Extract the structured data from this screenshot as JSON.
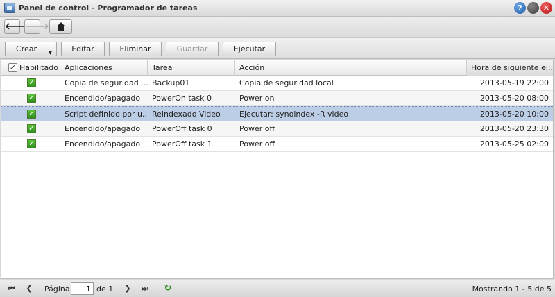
{
  "window": {
    "title": "Panel de control - Programador de tareas",
    "icon": "control-panel-icon",
    "help_glyph": "?",
    "close_glyph": "✕"
  },
  "nav": {
    "back_glyph": "🡐",
    "forward_glyph": "🡒"
  },
  "toolbar": {
    "create_label": "Crear",
    "edit_label": "Editar",
    "delete_label": "Eliminar",
    "save_label": "Guardar",
    "run_label": "Ejecutar"
  },
  "table": {
    "columns": [
      "Habilitado",
      "Aplicaciones",
      "Tarea",
      "Acción",
      "Hora de siguiente ej..."
    ],
    "rows": [
      {
        "enabled": true,
        "app": "Copia de seguridad ...",
        "task": "Backup01",
        "action": "Copia de seguridad local",
        "next": "2013-05-19 22:00"
      },
      {
        "enabled": true,
        "app": "Encendido/apagado",
        "task": "PowerOn task 0",
        "action": "Power on",
        "next": "2013-05-20 08:00"
      },
      {
        "enabled": true,
        "app": "Script definido por u...",
        "task": "Reindexado Video",
        "action": "Ejecutar: synoindex -R video",
        "next": "2013-05-20 10:00",
        "selected": true
      },
      {
        "enabled": true,
        "app": "Encendido/apagado",
        "task": "PowerOff task 0",
        "action": "Power off",
        "next": "2013-05-20 23:30"
      },
      {
        "enabled": true,
        "app": "Encendido/apagado",
        "task": "PowerOff task 1",
        "action": "Power off",
        "next": "2013-05-25 02:00"
      }
    ]
  },
  "pager": {
    "page_label": "Página",
    "page_value": "1",
    "of_label": "de 1",
    "status": "Mostrando 1 - 5 de 5"
  },
  "colors": {
    "selected_row": "#bccde6",
    "checkbox_green": "#3ea82a"
  }
}
